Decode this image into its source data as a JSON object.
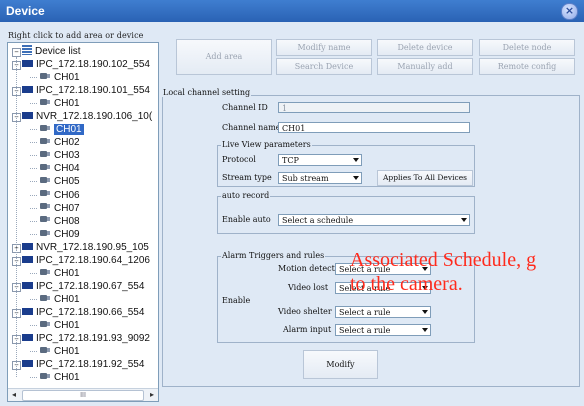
{
  "window": {
    "title": "Device",
    "close_icon": "close-icon"
  },
  "tree": {
    "hint": "Right click to add area or device",
    "root": "Device list",
    "nodes": [
      {
        "label": "IPC_172.18.190.102_554"
      },
      {
        "label": "CH01"
      },
      {
        "label": "IPC_172.18.190.101_554"
      },
      {
        "label": "CH01"
      },
      {
        "label": "NVR_172.18.190.106_10("
      },
      {
        "label": "CH01"
      },
      {
        "label": "CH02"
      },
      {
        "label": "CH03"
      },
      {
        "label": "CH04"
      },
      {
        "label": "CH05"
      },
      {
        "label": "CH06"
      },
      {
        "label": "CH07"
      },
      {
        "label": "CH08"
      },
      {
        "label": "CH09"
      },
      {
        "label": "NVR_172.18.190.95_105"
      },
      {
        "label": "IPC_172.18.190.64_1206"
      },
      {
        "label": "CH01"
      },
      {
        "label": "IPC_172.18.190.67_554"
      },
      {
        "label": "CH01"
      },
      {
        "label": "IPC_172.18.190.66_554"
      },
      {
        "label": "CH01"
      },
      {
        "label": "IPC_172.18.191.93_9092"
      },
      {
        "label": "CH01"
      },
      {
        "label": "IPC_172.18.191.92_554"
      },
      {
        "label": "CH01"
      }
    ],
    "scroll_thumb": "III"
  },
  "toolbar": {
    "add_area": "Add area",
    "modify_name": "Modify name",
    "delete_device": "Delete device",
    "delete_node": "Delete node",
    "search_device": "Search Device",
    "manually_add": "Manually add",
    "remote_config": "Remote config"
  },
  "channel": {
    "group_title": "Local channel setting",
    "id_label": "Channel ID",
    "id_value": "1",
    "name_label": "Channel name",
    "name_value": "CH01"
  },
  "live_view": {
    "group_title": "Live View parameters",
    "protocol_label": "Protocol",
    "protocol_value": "TCP",
    "stream_label": "Stream type",
    "stream_value": "Sub stream",
    "apply_all": "Applies To All Devices"
  },
  "auto_record": {
    "group_title": "auto record",
    "enable_label": "Enable auto",
    "schedule_value": "Select a schedule"
  },
  "alarm": {
    "group_title": "Alarm Triggers and rules",
    "enable_label": "Enable",
    "motion_label": "Motion detect",
    "motion_value": "Select a rule",
    "video_lost_label": "Video lost",
    "video_lost_value": "Select a rule",
    "video_shelter_label": "Video shelter",
    "video_shelter_value": "Select a rule",
    "alarm_input_label": "Alarm input",
    "alarm_input_value": "Select a rule"
  },
  "modify_button": "Modify",
  "annotation": {
    "line1": "Associated Schedule, g",
    "line2": "to the camera."
  }
}
